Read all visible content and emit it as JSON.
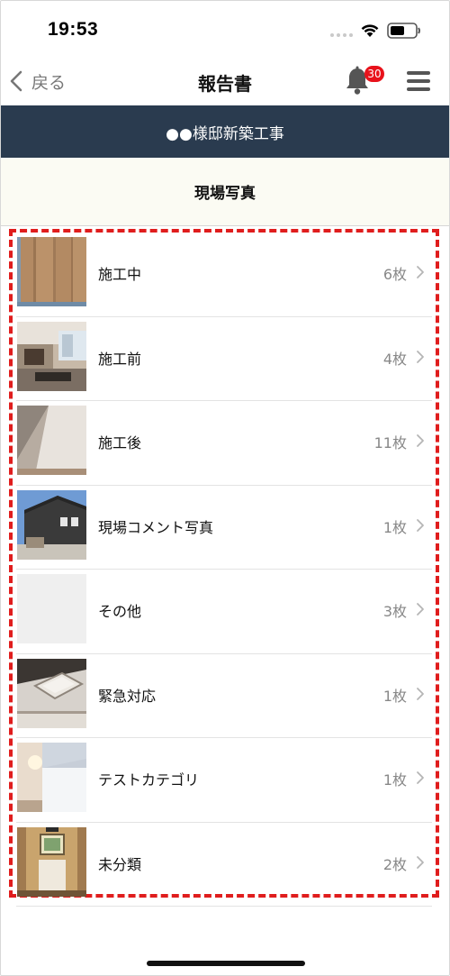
{
  "status_bar": {
    "time": "19:53"
  },
  "nav": {
    "back_label": "戻る",
    "title": "報告書",
    "notification_count": "30"
  },
  "project": {
    "name": "●●様邸新築工事"
  },
  "section": {
    "title": "現場写真"
  },
  "categories": [
    {
      "label": "施工中",
      "count": "6枚"
    },
    {
      "label": "施工前",
      "count": "4枚"
    },
    {
      "label": "施工後",
      "count": "11枚"
    },
    {
      "label": "現場コメント写真",
      "count": "1枚"
    },
    {
      "label": "その他",
      "count": "3枚"
    },
    {
      "label": "緊急対応",
      "count": "1枚"
    },
    {
      "label": "テストカテゴリ",
      "count": "1枚"
    },
    {
      "label": "未分類",
      "count": "2枚"
    }
  ],
  "colors": {
    "header_band": "#2a3b4f",
    "badge": "#e8121b",
    "highlight_border": "#e01d1d"
  }
}
